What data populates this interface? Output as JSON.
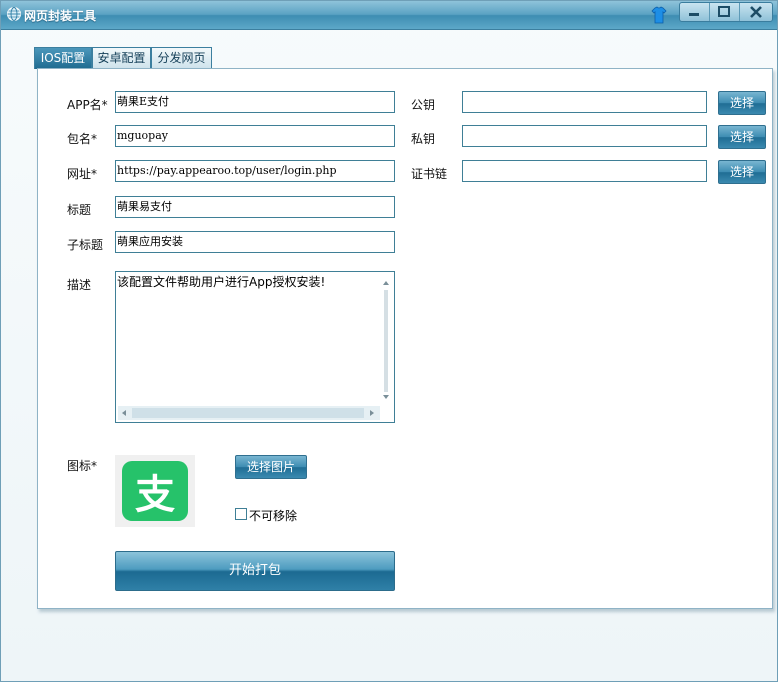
{
  "window": {
    "title": "网页封装工具"
  },
  "tabs": [
    {
      "label": "IOS配置",
      "active": true
    },
    {
      "label": "安卓配置",
      "active": false
    },
    {
      "label": "分发网页",
      "active": false
    }
  ],
  "form": {
    "app_name": {
      "label": "APP名*",
      "value": "萌果E支付"
    },
    "package": {
      "label": "包名*",
      "value": "mguopay"
    },
    "url": {
      "label": "网址*",
      "value": "https://pay.appearoo.top/user/login.php"
    },
    "title": {
      "label": "标题",
      "value": "萌果易支付"
    },
    "subtitle": {
      "label": "子标题",
      "value": "萌果应用安装"
    },
    "description": {
      "label": "描述",
      "value": "该配置文件帮助用户进行App授权安装!"
    },
    "public_key": {
      "label": "公钥",
      "value": "",
      "button": "选择"
    },
    "private_key": {
      "label": "私钥",
      "value": "",
      "button": "选择"
    },
    "cert_chain": {
      "label": "证书链",
      "value": "",
      "button": "选择"
    },
    "icon": {
      "label": "图标*",
      "choose_button": "选择图片",
      "icon_glyph": "支"
    },
    "non_removable": {
      "label": "不可移除",
      "checked": false
    },
    "start_button": "开始打包"
  },
  "colors": {
    "accent": "#1f6d94",
    "icon_green": "#26c26a"
  }
}
